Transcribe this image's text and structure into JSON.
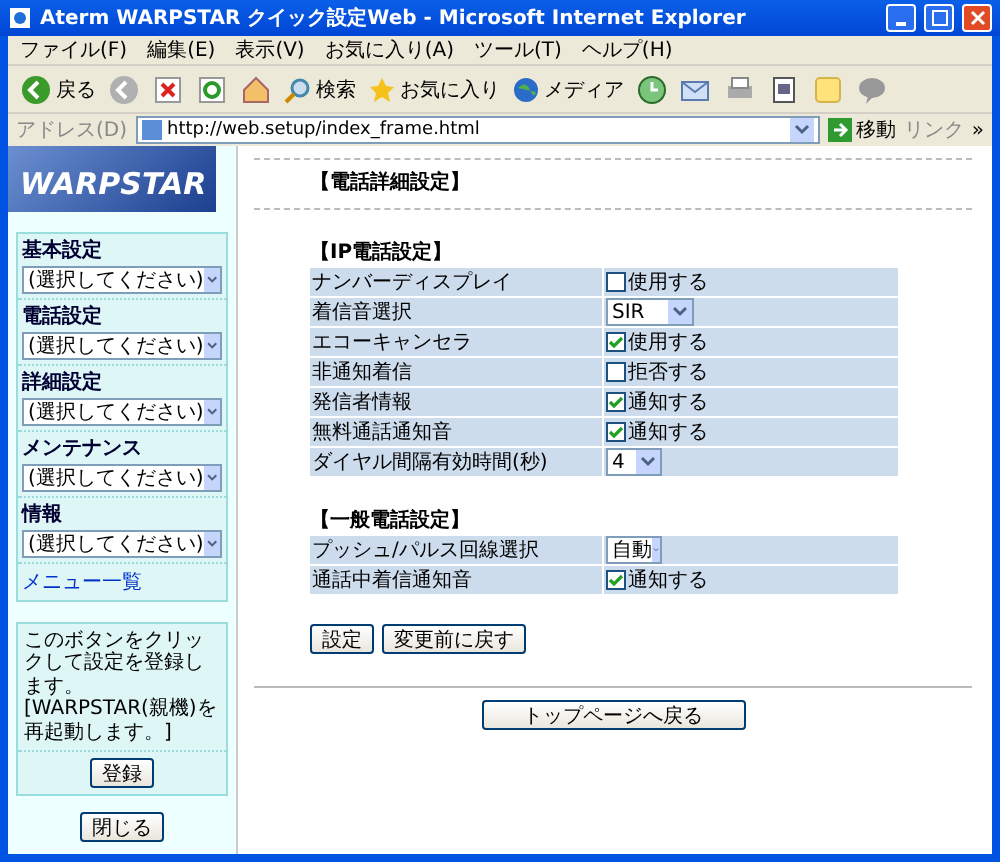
{
  "window": {
    "title": "Aterm WARPSTAR クイック設定Web - Microsoft Internet Explorer"
  },
  "menu_bar": [
    "ファイル(F)",
    "編集(E)",
    "表示(V)",
    "お気に入り(A)",
    "ツール(T)",
    "ヘルプ(H)"
  ],
  "toolbar": {
    "back": "戻る",
    "search": "検索",
    "favorites": "お気に入り",
    "media": "メディア"
  },
  "address_bar": {
    "label": "アドレス(D)",
    "url": "http://web.setup/index_frame.html",
    "go": "移動",
    "links": "リンク",
    "more": "»"
  },
  "sidebar": {
    "logo": "WARPSTAR",
    "menus": [
      {
        "label": "基本設定",
        "value": "(選択してください)"
      },
      {
        "label": "電話設定",
        "value": "(選択してください)"
      },
      {
        "label": "詳細設定",
        "value": "(選択してください)"
      },
      {
        "label": "メンテナンス",
        "value": "(選択してください)"
      },
      {
        "label": "情報",
        "value": "(選択してください)"
      }
    ],
    "menu_list_link": "メニュー一覧",
    "note": "このボタンをクリックして設定を登録します。[WARPSTAR(親機)を再起動します。]",
    "register_button": "登録",
    "close_button": "閉じる"
  },
  "page": {
    "title": "【電話詳細設定】",
    "sections": [
      {
        "heading": "【IP電話設定】",
        "rows": [
          {
            "label": "ナンバーディスプレイ",
            "kind": "checkbox",
            "checked": false,
            "option": "使用する"
          },
          {
            "label": "着信音選択",
            "kind": "select",
            "value": "SIR"
          },
          {
            "label": "エコーキャンセラ",
            "kind": "checkbox",
            "checked": true,
            "option": "使用する"
          },
          {
            "label": "非通知着信",
            "kind": "checkbox",
            "checked": false,
            "option": "拒否する"
          },
          {
            "label": "発信者情報",
            "kind": "checkbox",
            "checked": true,
            "option": "通知する"
          },
          {
            "label": "無料通話通知音",
            "kind": "checkbox",
            "checked": true,
            "option": "通知する"
          },
          {
            "label": "ダイヤル間隔有効時間(秒)",
            "kind": "select",
            "value": "4"
          }
        ]
      },
      {
        "heading": "【一般電話設定】",
        "rows": [
          {
            "label": "プッシュ/パルス回線選択",
            "kind": "select",
            "value": "自動"
          },
          {
            "label": "通話中着信通知音",
            "kind": "checkbox",
            "checked": true,
            "option": "通知する"
          }
        ]
      }
    ],
    "buttons": [
      "設定",
      "変更前に戻す"
    ],
    "top_button": "トップページへ戻る"
  }
}
